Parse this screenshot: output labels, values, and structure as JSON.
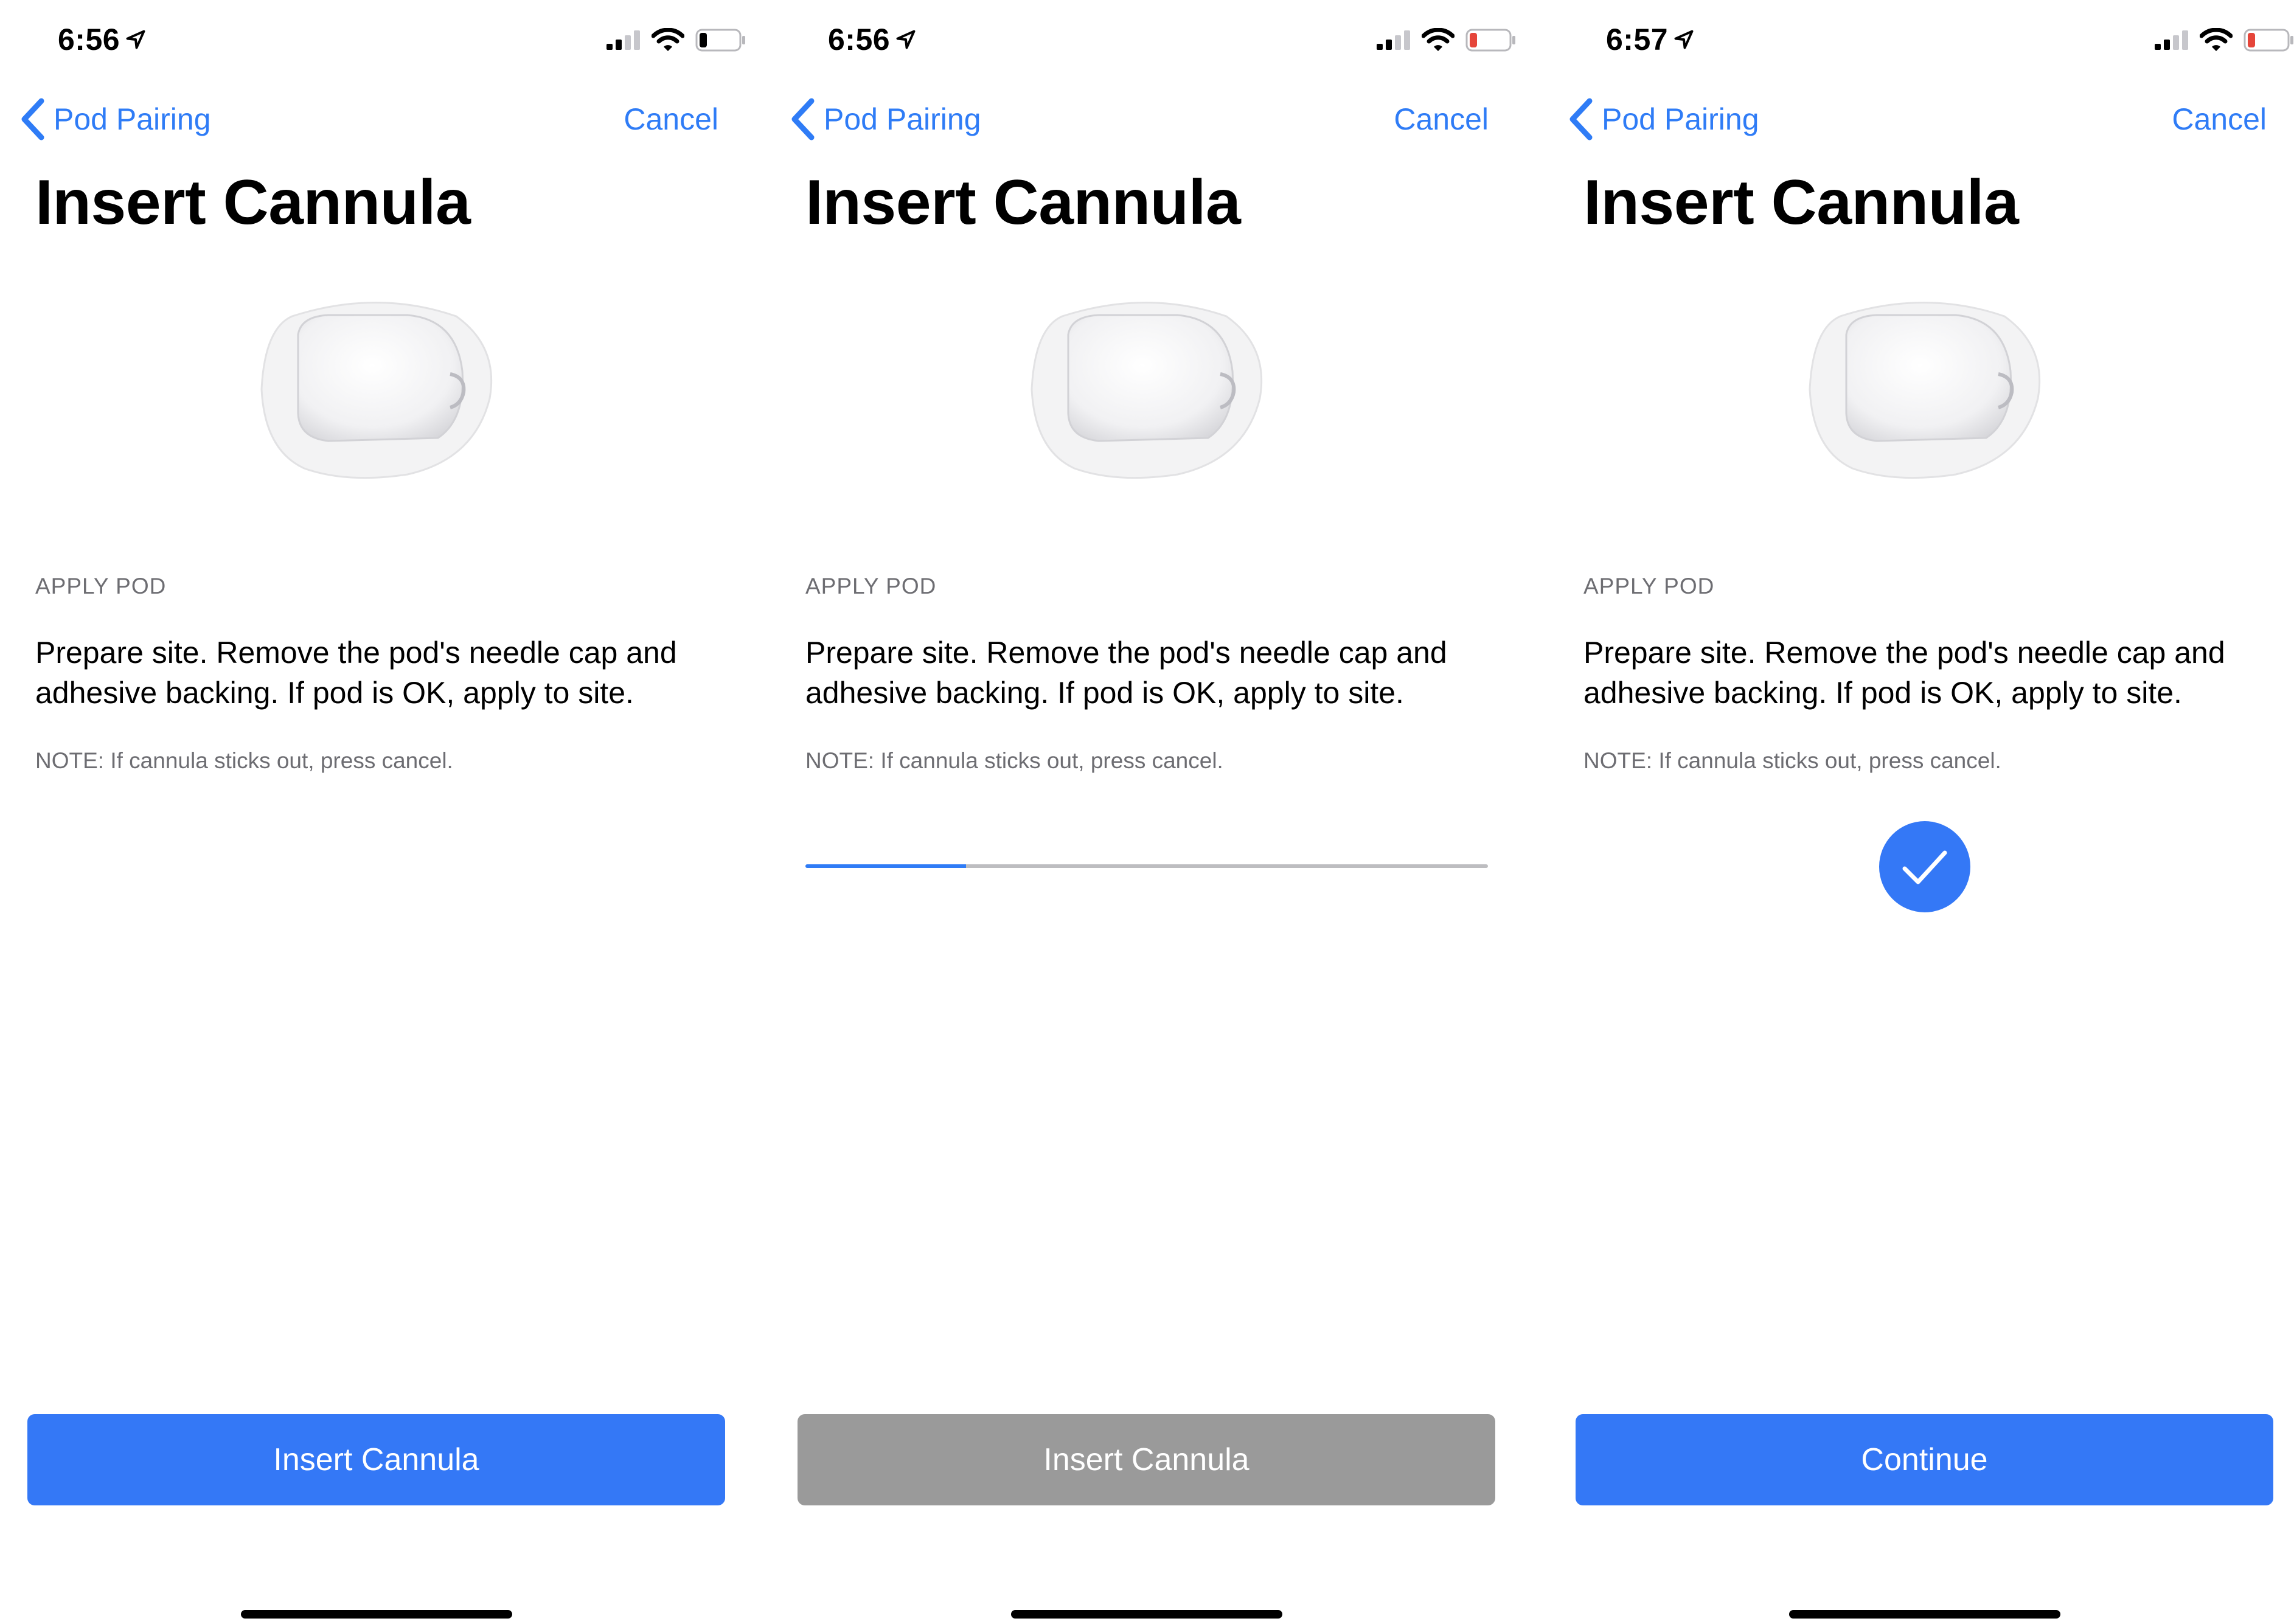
{
  "colors": {
    "accent": "#2f7cf6",
    "button_blue": "#3478f6",
    "button_disabled": "#9a9a9a",
    "secondary_text": "#6d6d72",
    "battery_low": "#e5453a"
  },
  "screens": [
    {
      "status": {
        "time": "6:56",
        "battery_color": "#000000",
        "battery_level": 0.2
      },
      "nav": {
        "back_label": "Pod Pairing",
        "cancel_label": "Cancel"
      },
      "title": "Insert Cannula",
      "section_label": "APPLY POD",
      "instructions": "Prepare site. Remove the pod's needle cap and adhesive backing. If pod is OK, apply to site.",
      "note": "NOTE: If cannula sticks out, press cancel.",
      "button": {
        "label": "Insert Cannula",
        "enabled": true
      }
    },
    {
      "status": {
        "time": "6:56",
        "battery_color": "#e5453a",
        "battery_level": 0.2
      },
      "nav": {
        "back_label": "Pod Pairing",
        "cancel_label": "Cancel"
      },
      "title": "Insert Cannula",
      "section_label": "APPLY POD",
      "instructions": "Prepare site. Remove the pod's needle cap and adhesive backing. If pod is OK, apply to site.",
      "note": "NOTE: If cannula sticks out, press cancel.",
      "progress": 0.235,
      "button": {
        "label": "Insert Cannula",
        "enabled": false
      }
    },
    {
      "status": {
        "time": "6:57",
        "battery_color": "#e5453a",
        "battery_level": 0.2
      },
      "nav": {
        "back_label": "Pod Pairing",
        "cancel_label": "Cancel"
      },
      "title": "Insert Cannula",
      "section_label": "APPLY POD",
      "instructions": "Prepare site. Remove the pod's needle cap and adhesive backing. If pod is OK, apply to site.",
      "note": "NOTE: If cannula sticks out, press cancel.",
      "completed_icon": "checkmark-circle-icon",
      "button": {
        "label": "Continue",
        "enabled": true
      }
    }
  ]
}
